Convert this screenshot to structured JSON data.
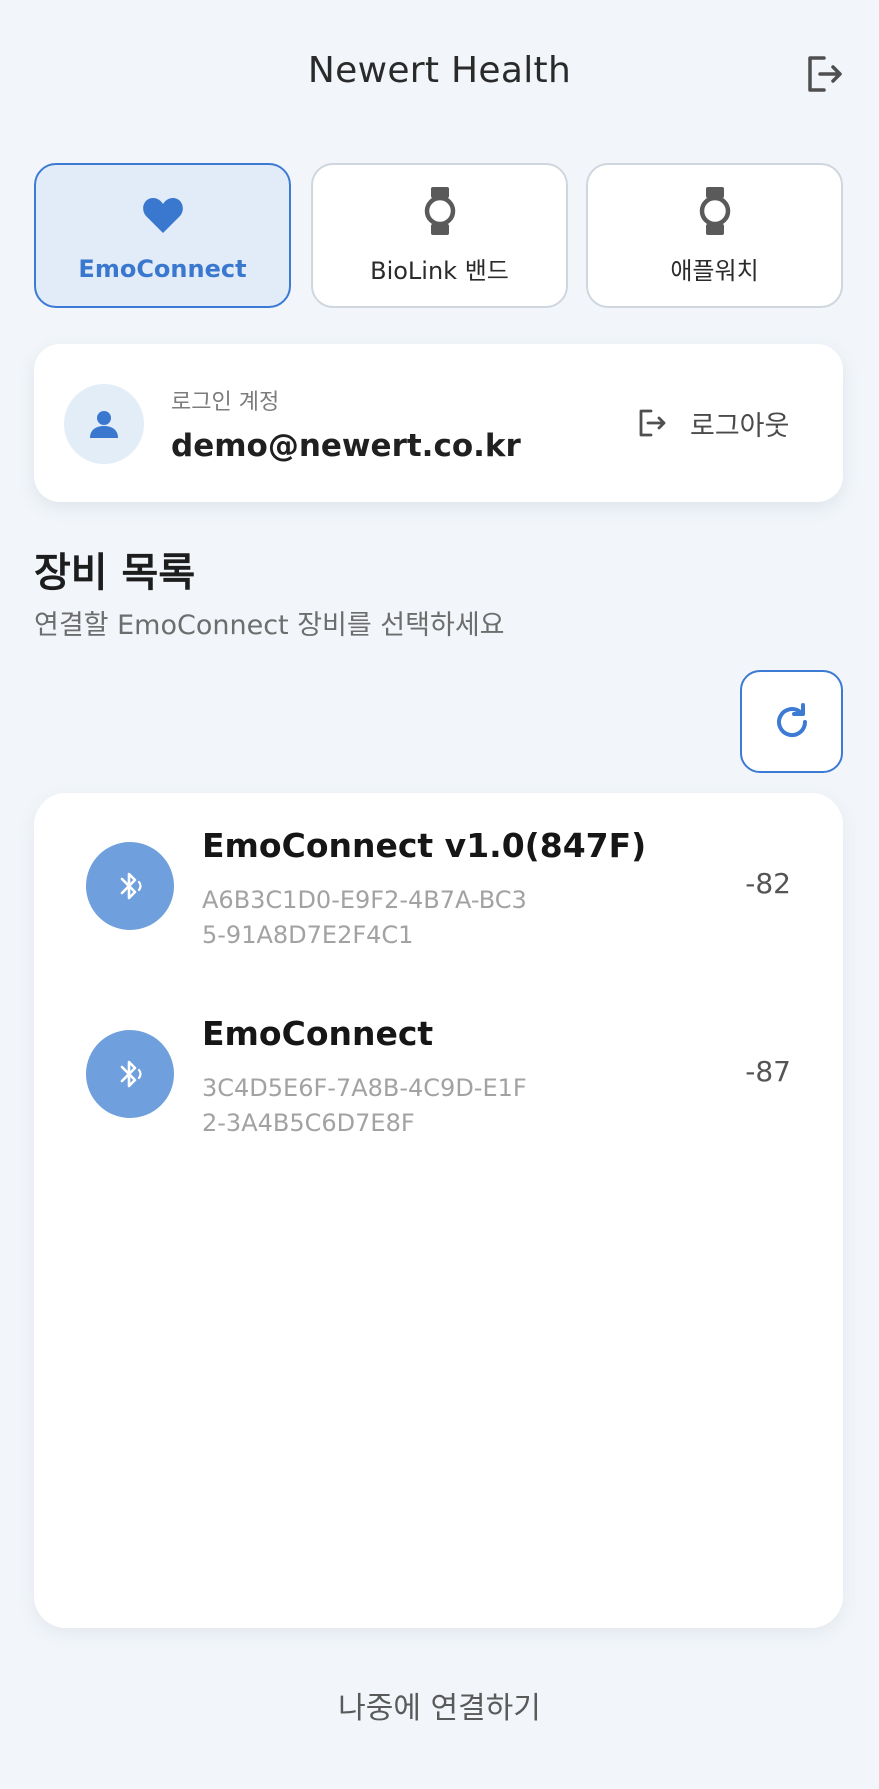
{
  "header": {
    "title": "Newert Health",
    "exit_icon": "exit-icon"
  },
  "tabs": [
    {
      "label": "EmoConnect",
      "icon": "heart-icon",
      "active": true
    },
    {
      "label": "BioLink 밴드",
      "icon": "watch-icon",
      "active": false
    },
    {
      "label": "애플워치",
      "icon": "watch-icon",
      "active": false
    }
  ],
  "account": {
    "caption": "로그인 계정",
    "email": "demo@newert.co.kr",
    "logout_label": "로그아웃",
    "avatar_icon": "person-icon"
  },
  "devices_section": {
    "title": "장비 목록",
    "subtitle": "연결할 EmoConnect 장비를 선택하세요",
    "refresh_icon": "refresh-icon"
  },
  "devices": [
    {
      "name": "EmoConnect v1.0(847F)",
      "id": "A6B3C1D0-E9F2-4B7A-BC35-91A8D7E2F4C1",
      "rssi": "-82",
      "icon": "bluetooth-icon"
    },
    {
      "name": "EmoConnect",
      "id": "3C4D5E6F-7A8B-4C9D-E1F2-3A4B5C6D7E8F",
      "rssi": "-87",
      "icon": "bluetooth-icon"
    }
  ],
  "footer": {
    "later_label": "나중에 연결하기"
  },
  "colors": {
    "accent": "#3d7ad4",
    "accent_light": "#e1ecf8",
    "bluetooth_bg": "#6f9fdc",
    "background": "#f2f6fa"
  }
}
